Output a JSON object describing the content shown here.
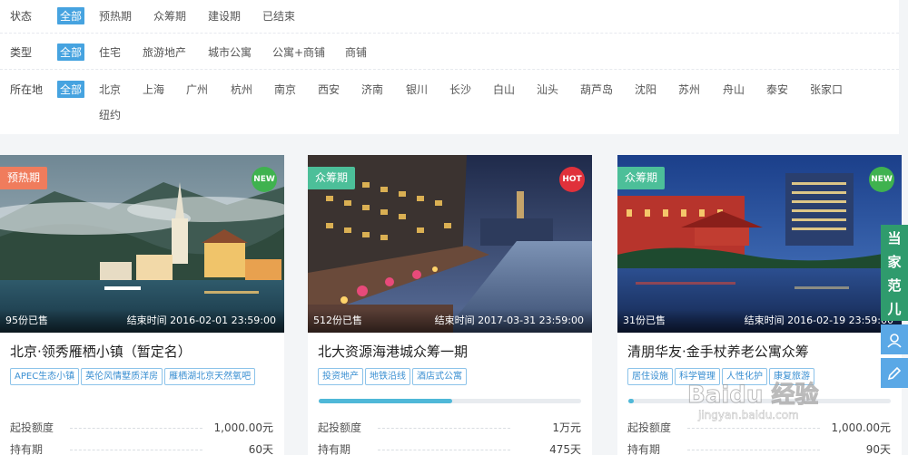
{
  "filters": {
    "status": {
      "label": "状态",
      "options": [
        "全部",
        "预热期",
        "众筹期",
        "建设期",
        "已结束"
      ],
      "selected": "全部"
    },
    "type": {
      "label": "类型",
      "options": [
        "全部",
        "住宅",
        "旅游地产",
        "城市公寓",
        "公寓+商铺",
        "商铺"
      ],
      "selected": "全部"
    },
    "location": {
      "label": "所在地",
      "options": [
        "全部",
        "北京",
        "上海",
        "广州",
        "杭州",
        "南京",
        "西安",
        "济南",
        "银川",
        "长沙",
        "白山",
        "汕头",
        "葫芦岛",
        "沈阳",
        "苏州",
        "舟山",
        "泰安",
        "张家口",
        "纽约"
      ],
      "selected": "全部"
    }
  },
  "cards": [
    {
      "stage": "预热期",
      "badge": "NEW",
      "sold": "95份已售",
      "end_time": "结束时间 2016-02-01 23:59:00",
      "title": "北京·领秀雁栖小镇（暂定名）",
      "tags": [
        "APEC生态小镇",
        "英伦风情墅质洋房",
        "雁栖湖北京天然氧吧"
      ],
      "progress": null,
      "min_invest_label": "起投额度",
      "min_invest": "1,000.00元",
      "hold_label": "持有期",
      "hold": "60天"
    },
    {
      "stage": "众筹期",
      "badge": "HOT",
      "sold": "512份已售",
      "end_time": "结束时间 2017-03-31 23:59:00",
      "title": "北大资源海港城众筹一期",
      "tags": [
        "投资地产",
        "地铁沿线",
        "酒店式公寓"
      ],
      "progress": 0.51,
      "min_invest_label": "起投额度",
      "min_invest": "1万元",
      "hold_label": "持有期",
      "hold": "475天"
    },
    {
      "stage": "众筹期",
      "badge": "NEW",
      "sold": "31份已售",
      "end_time": "结束时间 2016-02-19 23:59:00",
      "title": "清朋华友·金手杖养老公寓众筹",
      "tags": [
        "居住设施",
        "科学管理",
        "人性化护",
        "康复旅游"
      ],
      "progress": 0.02,
      "min_invest_label": "起投额度",
      "min_invest": "1,000.00元",
      "hold_label": "持有期",
      "hold": "90天"
    }
  ],
  "sidebar": {
    "banner_chars": [
      "当",
      "家",
      "范",
      "儿"
    ]
  },
  "watermark": {
    "logo": "Baidu 经验",
    "url": "jingyan.baidu.com"
  }
}
